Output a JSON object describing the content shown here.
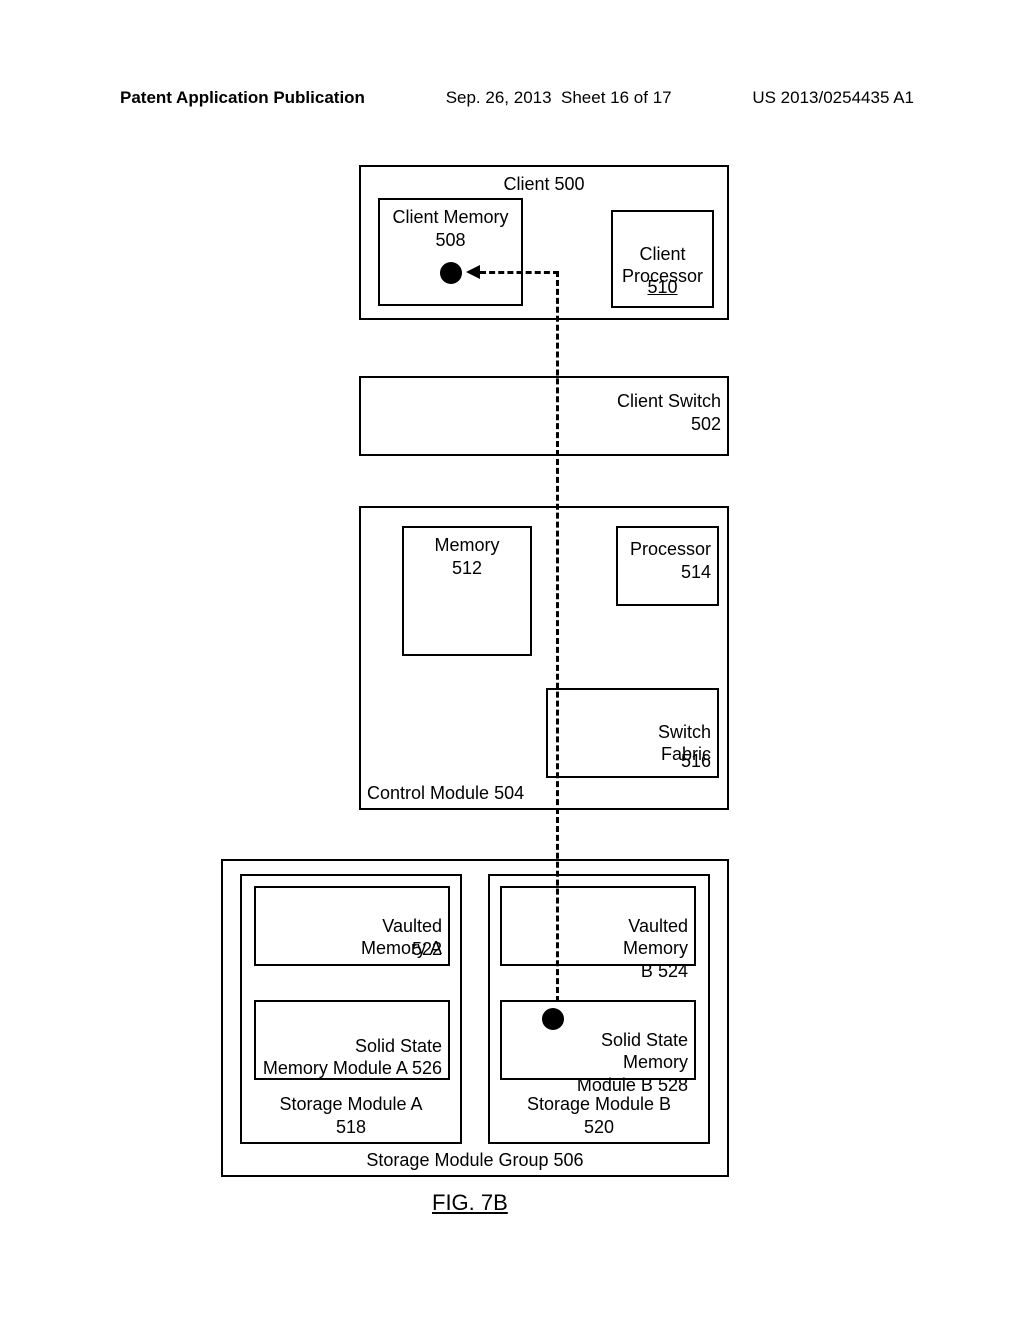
{
  "header": {
    "publication": "Patent Application Publication",
    "date": "Sep. 26, 2013",
    "sheet": "Sheet 16 of 17",
    "docnum": "US 2013/0254435 A1"
  },
  "client": {
    "title": "Client",
    "title_ref": "500",
    "memory": "Client Memory",
    "memory_ref": "508",
    "processor": "Client\nProcessor",
    "processor_ref": "510"
  },
  "client_switch": {
    "title": "Client Switch",
    "ref": "502"
  },
  "control_module": {
    "title": "Control Module",
    "ref": "504",
    "memory": "Memory",
    "memory_ref": "512",
    "processor": "Processor",
    "processor_ref": "514",
    "switch_fabric": "Switch\nFabric",
    "switch_fabric_ref": "516"
  },
  "storage_group": {
    "title": "Storage Module Group",
    "ref": "506",
    "A": {
      "title": "Storage Module A",
      "ref": "518",
      "vaulted": "Vaulted\nMemory A",
      "vaulted_ref": "522",
      "ssm": "Solid State\nMemory Module A",
      "ssm_ref": "526"
    },
    "B": {
      "title": "Storage Module B",
      "ref": "520",
      "vaulted": "Vaulted\nMemory\nB",
      "vaulted_ref": "524",
      "ssm": "Solid State\nMemory\nModule B",
      "ssm_ref": "528"
    }
  },
  "figure": "FIG. 7B"
}
